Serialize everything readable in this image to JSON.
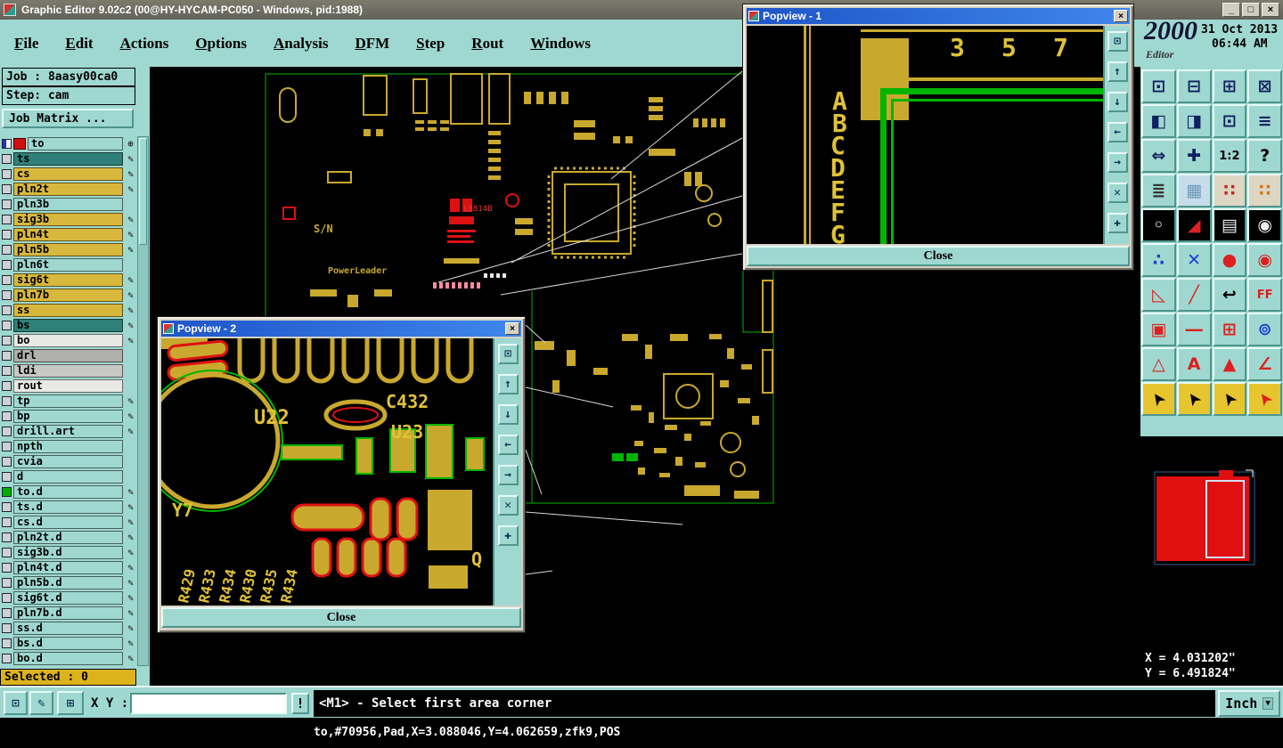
{
  "titlebar": {
    "title": "Graphic Editor 9.02c2 (00@HY-HYCAM-PC050 - Windows, pid:1988)",
    "controls": {
      "minimize": "_",
      "maximize": "□",
      "close": "×"
    }
  },
  "icons": {
    "close": "×"
  },
  "menu": {
    "items": [
      "File",
      "Edit",
      "Actions",
      "Options",
      "Analysis",
      "DFM",
      "Step",
      "Rout",
      "Windows"
    ]
  },
  "sidebar": {
    "job": "Job : 8aasy00ca0",
    "step": "Step: cam",
    "job_matrix": "Job Matrix ...",
    "selected": "Selected : 0",
    "layers": [
      {
        "name": "to",
        "bg": "teal",
        "chip": "#d01010",
        "glyph": "⊕",
        "check": "half"
      },
      {
        "name": "ts",
        "bg": "#2f8078",
        "glyph": "✎"
      },
      {
        "name": "cs",
        "bg": "#d8b83c",
        "glyph": "✎"
      },
      {
        "name": "pln2t",
        "bg": "#d8b83c",
        "glyph": "✎"
      },
      {
        "name": "pln3b",
        "bg": "teal",
        "glyph": ""
      },
      {
        "name": "sig3b",
        "bg": "#d8b83c",
        "glyph": "✎"
      },
      {
        "name": "pln4t",
        "bg": "#d8b83c",
        "glyph": "✎"
      },
      {
        "name": "pln5b",
        "bg": "#d8b83c",
        "glyph": "✎"
      },
      {
        "name": "pln6t",
        "bg": "teal",
        "glyph": ""
      },
      {
        "name": "sig6t",
        "bg": "#d8b83c",
        "glyph": "✎"
      },
      {
        "name": "pln7b",
        "bg": "#d8b83c",
        "glyph": "✎"
      },
      {
        "name": "ss",
        "bg": "#d8b83c",
        "glyph": "✎"
      },
      {
        "name": "bs",
        "bg": "#2f8078",
        "glyph": "✎"
      },
      {
        "name": "bo",
        "bg": "#e8e8e4",
        "glyph": "✎"
      },
      {
        "name": "drl",
        "bg": "#b0b0ac",
        "glyph": ""
      },
      {
        "name": "ldi",
        "bg": "#c8c8c4",
        "glyph": ""
      },
      {
        "name": "rout",
        "bg": "#e8e8e4",
        "glyph": ""
      },
      {
        "name": "tp",
        "bg": "teal",
        "glyph": "✎"
      },
      {
        "name": "bp",
        "bg": "teal",
        "glyph": "✎"
      },
      {
        "name": "drill.art",
        "bg": "teal",
        "glyph": "✎"
      },
      {
        "name": "npth",
        "bg": "teal",
        "glyph": ""
      },
      {
        "name": "cvia",
        "bg": "teal",
        "glyph": ""
      },
      {
        "name": "d",
        "bg": "teal",
        "glyph": ""
      },
      {
        "name": "to.d",
        "bg": "teal",
        "glyph": "✎",
        "check": "green"
      },
      {
        "name": "ts.d",
        "bg": "teal",
        "glyph": "✎"
      },
      {
        "name": "cs.d",
        "bg": "teal",
        "glyph": "✎"
      },
      {
        "name": "pln2t.d",
        "bg": "teal",
        "glyph": "✎"
      },
      {
        "name": "sig3b.d",
        "bg": "teal",
        "glyph": "✎"
      },
      {
        "name": "pln4t.d",
        "bg": "teal",
        "glyph": "✎"
      },
      {
        "name": "pln5b.d",
        "bg": "teal",
        "glyph": "✎"
      },
      {
        "name": "sig6t.d",
        "bg": "teal",
        "glyph": "✎"
      },
      {
        "name": "pln7b.d",
        "bg": "teal",
        "glyph": "✎"
      },
      {
        "name": "ss.d",
        "bg": "teal",
        "glyph": "✎"
      },
      {
        "name": "bs.d",
        "bg": "teal",
        "glyph": "✎"
      },
      {
        "name": "bo.d",
        "bg": "teal",
        "glyph": "✎"
      }
    ]
  },
  "canvas": {
    "labels": [
      "S/N",
      "PowerLeader",
      "L3814B"
    ]
  },
  "popview1": {
    "title": "Popview - 1",
    "close": "Close",
    "numbers": [
      "3",
      "5",
      "7"
    ],
    "letters": [
      "A",
      "B",
      "C",
      "D",
      "E",
      "F",
      "G"
    ]
  },
  "popview2": {
    "title": "Popview - 2",
    "close": "Close",
    "labels": {
      "u22": "U22",
      "c432": "C432",
      "u23": "U23",
      "y7": "Y7",
      "q": "Q"
    },
    "r_labels": [
      "R429",
      "R433",
      "R434",
      "R430",
      "R435",
      "R434"
    ]
  },
  "popview_tools": [
    {
      "name": "overview-icon",
      "g": "⊡"
    },
    {
      "name": "pan-up-icon",
      "g": "↑"
    },
    {
      "name": "pan-down-icon",
      "g": "↓"
    },
    {
      "name": "pan-left-icon",
      "g": "←"
    },
    {
      "name": "pan-right-icon",
      "g": "→"
    },
    {
      "name": "zoom-out-icon",
      "g": "✕"
    },
    {
      "name": "pan-center-icon",
      "g": "✚"
    }
  ],
  "rightpanel": {
    "logo": "2000",
    "date": "31 Oct 2013",
    "time": "06:44 AM",
    "edition": "Editor",
    "coord_x": "X = 4.031202\"",
    "coord_y": "Y = 6.491824\"",
    "tools": [
      {
        "g": "⊡"
      },
      {
        "g": "⊟"
      },
      {
        "g": "⊞"
      },
      {
        "g": "⊠"
      },
      {
        "g": "◧"
      },
      {
        "g": "◨"
      },
      {
        "g": "⊡"
      },
      {
        "g": "≡"
      },
      {
        "g": "⇔"
      },
      {
        "g": "✚"
      },
      {
        "g": "1:2",
        "fg": "#000000"
      },
      {
        "g": "?",
        "fg": "#000000"
      },
      {
        "g": "≣",
        "fg": "#333333"
      },
      {
        "g": "▦",
        "fg": "#6a9ab8",
        "bg": "#c6dce8"
      },
      {
        "g": "∷",
        "fg": "#cc2020",
        "bg": "#ddd6c2"
      },
      {
        "g": "∷",
        "fg": "#d07818",
        "bg": "#ddd6c2"
      },
      {
        "g": "◦",
        "fg": "#ffffff",
        "bg": "#000000"
      },
      {
        "g": "◢",
        "fg": "#dd2020",
        "bg": "#000000"
      },
      {
        "g": "▤",
        "fg": "#eeeeee",
        "bg": "#000000"
      },
      {
        "g": "◉",
        "fg": "#eeeeee",
        "bg": "#000000"
      },
      {
        "g": "∴",
        "fg": "#2040d0"
      },
      {
        "g": "✕",
        "fg": "#2040d0"
      },
      {
        "g": "●",
        "fg": "#dd2020"
      },
      {
        "g": "◉",
        "fg": "#dd2020"
      },
      {
        "g": "◺",
        "fg": "#dd2020"
      },
      {
        "g": "╱",
        "fg": "#dd2020"
      },
      {
        "g": "↩",
        "fg": "#000000"
      },
      {
        "g": "FF",
        "fg": "#dd2020"
      },
      {
        "g": "▣",
        "fg": "#dd2020"
      },
      {
        "g": "―",
        "fg": "#dd2020"
      },
      {
        "g": "⊞",
        "fg": "#dd2020"
      },
      {
        "g": "⊚",
        "fg": "#2040d0"
      },
      {
        "g": "△",
        "fg": "#dd2020"
      },
      {
        "g": "A",
        "fg": "#dd2020"
      },
      {
        "g": "▲",
        "fg": "#dd2020"
      },
      {
        "g": "∠",
        "fg": "#dd2020"
      },
      {
        "g": "➤",
        "fg": "#000000",
        "bg": "#e7c52f",
        "rot": -125
      },
      {
        "g": "➤",
        "fg": "#000000",
        "bg": "#e7c52f",
        "rot": -125
      },
      {
        "g": "➤",
        "fg": "#000000",
        "bg": "#e7c52f",
        "rot": -125
      },
      {
        "g": "➤",
        "fg": "#dd2020",
        "bg": "#e7c52f",
        "rot": -125
      }
    ]
  },
  "bottombar": {
    "xy_label": "X Y :",
    "alert": "!",
    "message": "<M1> - Select first area corner",
    "units": "Inch",
    "units_arrow": "▼",
    "buttons": [
      {
        "name": "popview-icon",
        "g": "⊡"
      },
      {
        "name": "notes-icon",
        "g": "✎"
      },
      {
        "name": "grid-icon",
        "g": "⊞"
      }
    ]
  },
  "statusline": "to,#70956,Pad,X=3.088046,Y=4.062659,zfk9,POS"
}
